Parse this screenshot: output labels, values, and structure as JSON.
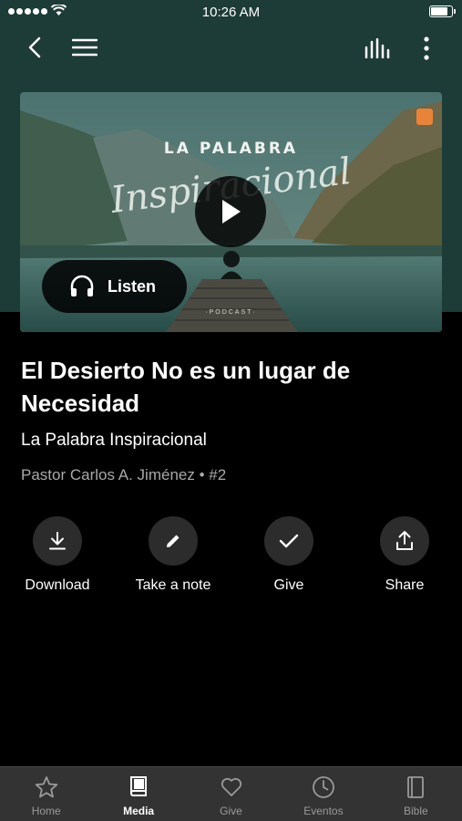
{
  "status_bar": {
    "time": "10:26 AM",
    "battery_level": 0.92
  },
  "nav": {
    "back_icon": "chevron-left-icon",
    "menu_icon": "hamburger-menu-icon",
    "stats_icon": "bars-icon",
    "more_icon": "more-vertical-icon"
  },
  "hero": {
    "title": "LA PALABRA",
    "script_title": "Inspiracional",
    "podcast_label": "·PODCAST·",
    "listen_label": "Listen",
    "play_icon": "play-icon",
    "headphones_icon": "headphones-icon"
  },
  "episode": {
    "title": "El Desierto No es un lugar de Necesidad",
    "podcast": "La Palabra Inspiracional",
    "meta": "Pastor Carlos A. Jiménez • #2"
  },
  "actions": [
    {
      "label": "Download",
      "icon": "download-icon"
    },
    {
      "label": "Take a note",
      "icon": "pencil-icon"
    },
    {
      "label": "Give",
      "icon": "check-icon"
    },
    {
      "label": "Share",
      "icon": "share-icon"
    }
  ],
  "tabs": [
    {
      "label": "Home",
      "icon": "star-icon",
      "active": false
    },
    {
      "label": "Media",
      "icon": "book-icon",
      "active": true
    },
    {
      "label": "Give",
      "icon": "heart-icon",
      "active": false
    },
    {
      "label": "Eventos",
      "icon": "clock-icon",
      "active": false
    },
    {
      "label": "Bible",
      "icon": "bible-icon",
      "active": false
    }
  ],
  "colors": {
    "header_bg": "#1d3b37",
    "background": "#000000",
    "tab_bar_bg": "#333333",
    "action_circle": "#2c2c2c",
    "meta_text": "#a9a9a9"
  }
}
